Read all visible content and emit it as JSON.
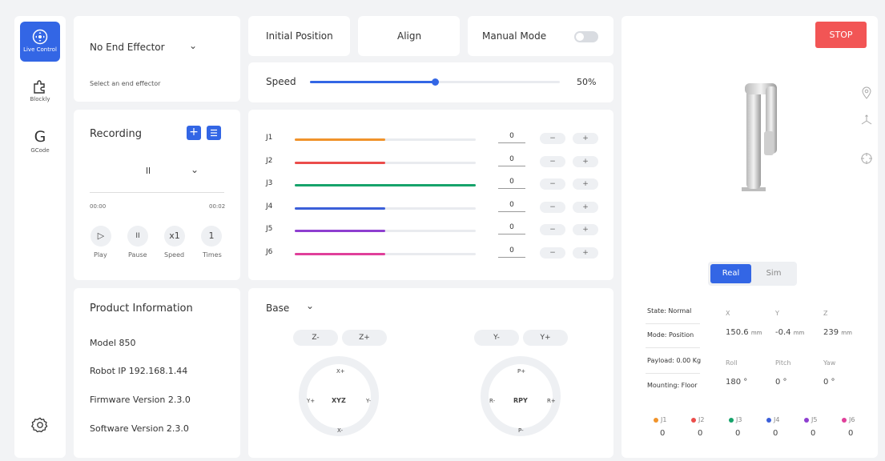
{
  "sidebar": {
    "items": [
      {
        "label": "Live Control",
        "icon": "live-control-icon"
      },
      {
        "label": "Blockly",
        "icon": "puzzle-icon"
      },
      {
        "label": "GCode",
        "icon": "gcode-icon",
        "glyph": "G"
      }
    ],
    "settings_icon": "gear-icon"
  },
  "end_effector": {
    "selected": "No End Effector",
    "hint": "Select an end effector"
  },
  "recording": {
    "title": "Recording",
    "selected": "ll",
    "time_start": "00:00",
    "time_end": "00:02",
    "controls": [
      {
        "glyph": "▷",
        "label": "Play"
      },
      {
        "glyph": "II",
        "label": "Pause"
      },
      {
        "glyph": "x1",
        "label": "Speed"
      },
      {
        "glyph": "1",
        "label": "Times"
      }
    ]
  },
  "product": {
    "title": "Product Information",
    "model": "Model  850",
    "ip": "Robot IP  192.168.1.44",
    "firmware": "Firmware Version  2.3.0",
    "software": "Software Version  2.3.0"
  },
  "toolbar": {
    "initial_position": "Initial Position",
    "align": "Align",
    "manual_mode": "Manual Mode",
    "manual_mode_on": false
  },
  "speed": {
    "label": "Speed",
    "value_text": "50%",
    "value": 0.5
  },
  "joints": [
    {
      "label": "J1",
      "value": "0",
      "fill": 0.5,
      "color": "#f0932b"
    },
    {
      "label": "J2",
      "value": "0",
      "fill": 0.5,
      "color": "#eb4d4b"
    },
    {
      "label": "J3",
      "value": "0",
      "fill": 1.0,
      "color": "#16a36b"
    },
    {
      "label": "J4",
      "value": "0",
      "fill": 0.5,
      "color": "#3b5fd9"
    },
    {
      "label": "J5",
      "value": "0",
      "fill": 0.5,
      "color": "#8e3fd0"
    },
    {
      "label": "J6",
      "value": "0",
      "fill": 0.5,
      "color": "#e0409a"
    }
  ],
  "jog": {
    "frame": "Base",
    "xyz": {
      "center": "XYZ",
      "zminus": "Z-",
      "zplus": "Z+",
      "xplus": "X+",
      "xminus": "X-",
      "yplus": "Y+",
      "yminus": "Y-"
    },
    "rpy": {
      "center": "RPY",
      "yminus": "Y-",
      "yplus": "Y+",
      "pplus": "P+",
      "pminus": "P-",
      "rminus": "R-",
      "rplus": "R+"
    }
  },
  "stop_label": "STOP",
  "view": {
    "real": "Real",
    "sim": "Sim",
    "active": "Real"
  },
  "status": {
    "state": "State: Normal",
    "mode": "Mode: Position",
    "payload": "Payload: 0.00 Kg",
    "mounting": "Mounting: Floor"
  },
  "pose": {
    "x_label": "X",
    "y_label": "Y",
    "z_label": "Z",
    "x": "150.6",
    "y": "-0.4",
    "z": "239",
    "unit": "mm",
    "roll_label": "Roll",
    "pitch_label": "Pitch",
    "yaw_label": "Yaw",
    "roll": "180 °",
    "pitch": "0 °",
    "yaw": "0 °"
  },
  "joint_readout": [
    {
      "label": "J1",
      "value": "0",
      "color": "#f0932b"
    },
    {
      "label": "J2",
      "value": "0",
      "color": "#eb4d4b"
    },
    {
      "label": "J3",
      "value": "0",
      "color": "#16a36b"
    },
    {
      "label": "J4",
      "value": "0",
      "color": "#3b5fd9"
    },
    {
      "label": "J5",
      "value": "0",
      "color": "#8e3fd0"
    },
    {
      "label": "J6",
      "value": "0",
      "color": "#e0409a"
    }
  ],
  "colors": {
    "accent": "#3366e5",
    "stop": "#f25555"
  }
}
